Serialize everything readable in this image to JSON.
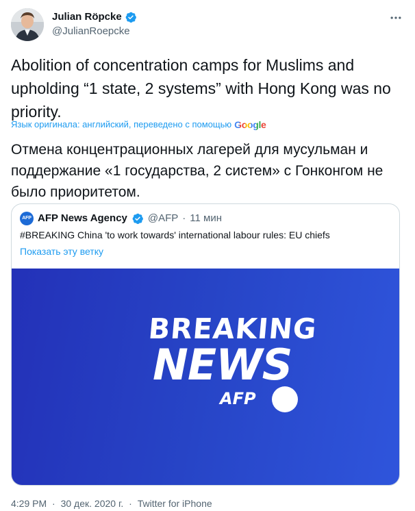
{
  "author": {
    "name": "Julian Röpcke",
    "handle": "@JulianRoepcke"
  },
  "tweet": {
    "text": "Abolition of concentration camps for Muslims and upholding “1 state, 2 systems” with Hong Kong was no priority.",
    "translation_note": "Язык оригинала: английский, переведено с помощью",
    "translation_provider": "Google",
    "translated_text": "Отмена концентрационных лагерей для мусульман и поддержание «1 государства, 2 систем» с Гонконгом не было приоритетом."
  },
  "quote": {
    "avatar_text": "AFP",
    "name": "AFP News Agency",
    "handle": "@AFP",
    "separator": "·",
    "time": "11 мин",
    "text": "#BREAKING China 'to work towards' international labour rules: EU chiefs",
    "show_thread": "Показать эту ветку",
    "media": {
      "line1": "BREAKING",
      "line2": "NEWS",
      "brand": "AFP"
    }
  },
  "footer": {
    "time": "4:29 PM",
    "date": "30 дек. 2020 г.",
    "source": "Twitter for iPhone",
    "separator": "·"
  },
  "colors": {
    "link": "#1d9bf0",
    "verified": "#1d9bf0",
    "media_bg": "#2a3fc4"
  },
  "icons": {
    "verified": "verified-badge-icon",
    "more": "more-options-icon"
  }
}
